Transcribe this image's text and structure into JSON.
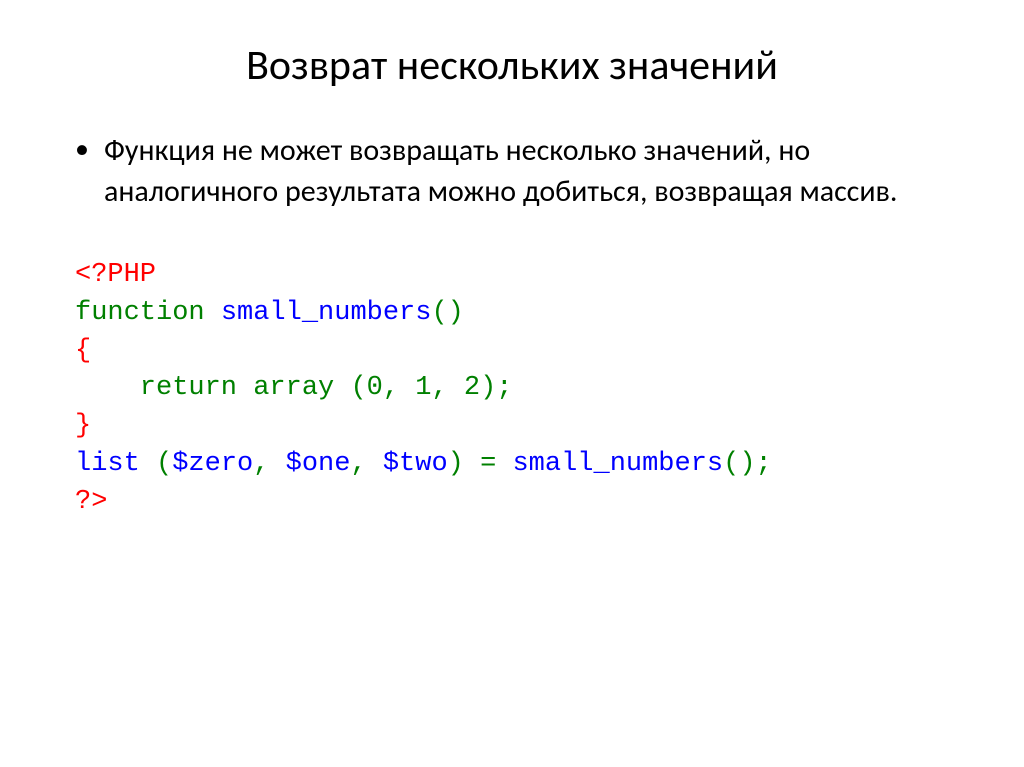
{
  "title": "Возврат нескольких значений",
  "bullet": {
    "marker": "•",
    "text": "Функция не может возвращать несколько значений, но аналогичного результата можно добиться, возвращая массив."
  },
  "code": {
    "open_tag": "<?PHP",
    "kw_function": "function",
    "func_name": "small_numbers",
    "paren_open": "(",
    "paren_close": ")",
    "brace_open": "{",
    "brace_close": "}",
    "indent": "    ",
    "kw_return": "return",
    "kw_array": "array",
    "num0": "0",
    "num1": "1",
    "num2": "2",
    "comma": ",",
    "semicolon": ";",
    "kw_list": "list",
    "var_zero": "$zero",
    "var_one": "$one",
    "var_two": "$two",
    "equals": "=",
    "close_tag": "?>"
  }
}
